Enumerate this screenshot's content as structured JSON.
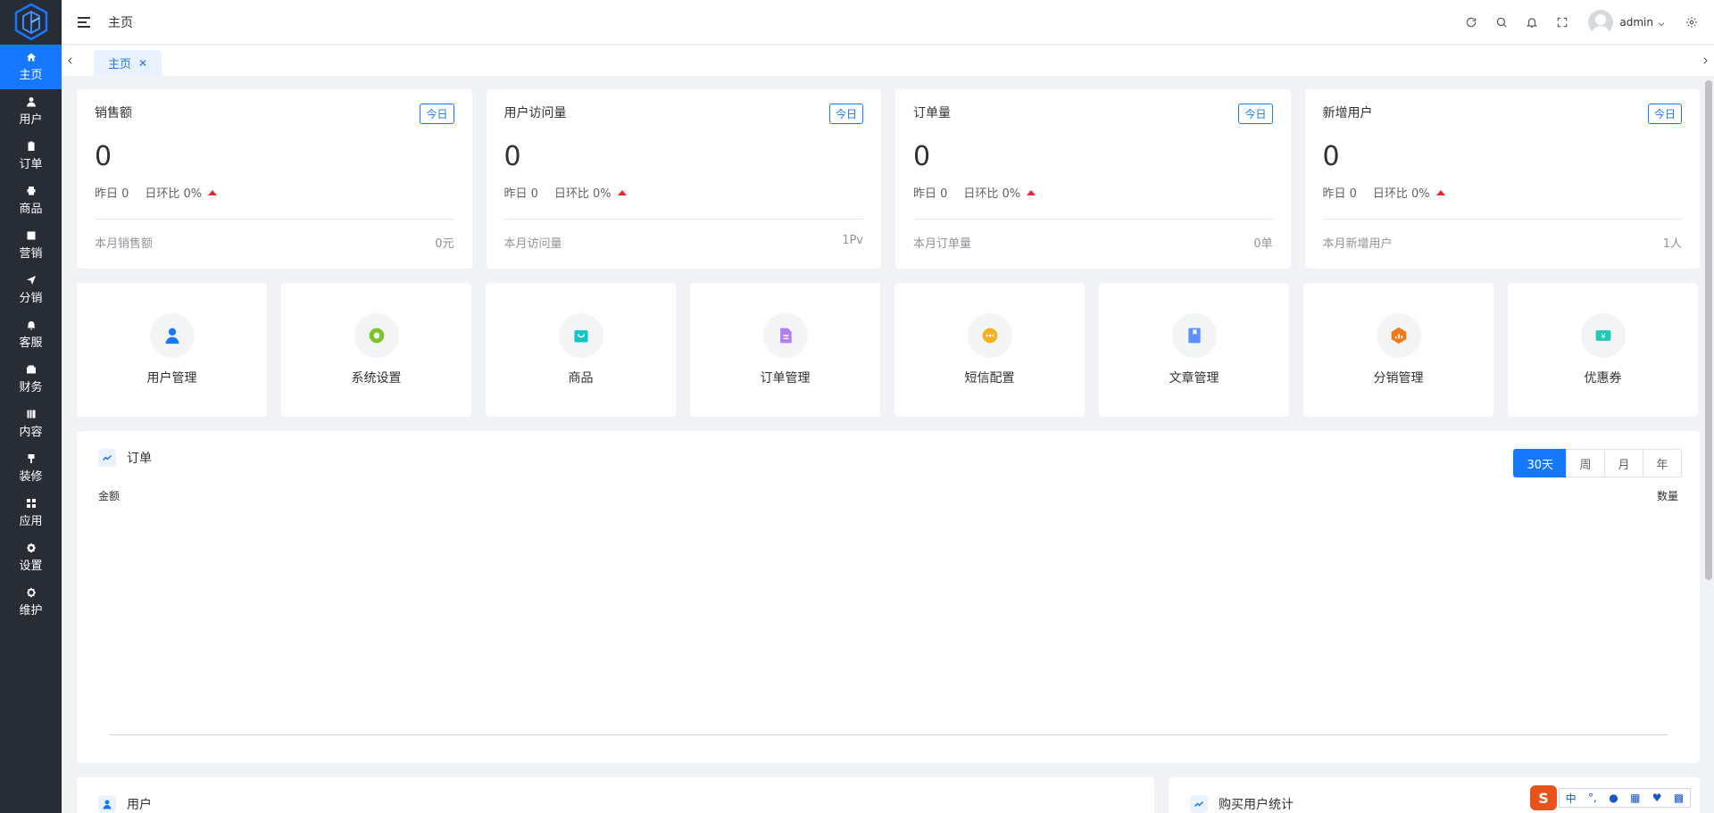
{
  "header": {
    "title": "主页",
    "username": "admin"
  },
  "sidebar": {
    "items": [
      {
        "label": "主页",
        "icon": "home-icon",
        "active": true
      },
      {
        "label": "用户",
        "icon": "user-icon"
      },
      {
        "label": "订单",
        "icon": "clipboard-icon"
      },
      {
        "label": "商品",
        "icon": "product-icon"
      },
      {
        "label": "营销",
        "icon": "chart-icon"
      },
      {
        "label": "分销",
        "icon": "send-icon"
      },
      {
        "label": "客服",
        "icon": "bell-icon"
      },
      {
        "label": "财务",
        "icon": "wallet-icon"
      },
      {
        "label": "内容",
        "icon": "content-icon"
      },
      {
        "label": "装修",
        "icon": "brush-icon"
      },
      {
        "label": "应用",
        "icon": "grid-icon"
      },
      {
        "label": "设置",
        "icon": "gear-icon"
      },
      {
        "label": "维护",
        "icon": "maintenance-icon"
      }
    ]
  },
  "tabs": {
    "active_label": "主页",
    "close": "✕"
  },
  "stats": [
    {
      "title": "销售额",
      "badge": "今日",
      "value": "0",
      "yesterday": "昨日 0",
      "ratio": "日环比 0%",
      "foot_label": "本月销售额",
      "foot_value": "0元"
    },
    {
      "title": "用户访问量",
      "badge": "今日",
      "value": "0",
      "yesterday": "昨日 0",
      "ratio": "日环比 0%",
      "foot_label": "本月访问量",
      "foot_value": "1Pv"
    },
    {
      "title": "订单量",
      "badge": "今日",
      "value": "0",
      "yesterday": "昨日 0",
      "ratio": "日环比 0%",
      "foot_label": "本月订单量",
      "foot_value": "0单"
    },
    {
      "title": "新增用户",
      "badge": "今日",
      "value": "0",
      "yesterday": "昨日 0",
      "ratio": "日环比 0%",
      "foot_label": "本月新增用户",
      "foot_value": "1人"
    }
  ],
  "quick_links": [
    {
      "label": "用户管理",
      "icon": "user-manage-icon",
      "color": "#1677ff"
    },
    {
      "label": "系统设置",
      "icon": "settings-icon",
      "color": "#7cc42a"
    },
    {
      "label": "商品",
      "icon": "bag-icon",
      "color": "#12c4c4"
    },
    {
      "label": "订单管理",
      "icon": "document-icon",
      "color": "#b47cf3"
    },
    {
      "label": "短信配置",
      "icon": "message-icon",
      "color": "#f5b120"
    },
    {
      "label": "文章管理",
      "icon": "bookmark-icon",
      "color": "#5b8ff9"
    },
    {
      "label": "分销管理",
      "icon": "distribution-icon",
      "color": "#f07a1a"
    },
    {
      "label": "优惠券",
      "icon": "coupon-icon",
      "color": "#1fc7b5"
    }
  ],
  "order_chart": {
    "title": "订单",
    "periods": [
      "30天",
      "周",
      "月",
      "年"
    ],
    "active_period": "30天",
    "left_axis": "金额",
    "right_axis": "数量"
  },
  "bottom": {
    "user_title": "用户",
    "purchase_title": "购买用户统计"
  },
  "ime": {
    "logo": "S",
    "mode": "中"
  },
  "colors": {
    "primary": "#1677ff",
    "sidebar": "#282c34",
    "up": "#f5222d"
  }
}
